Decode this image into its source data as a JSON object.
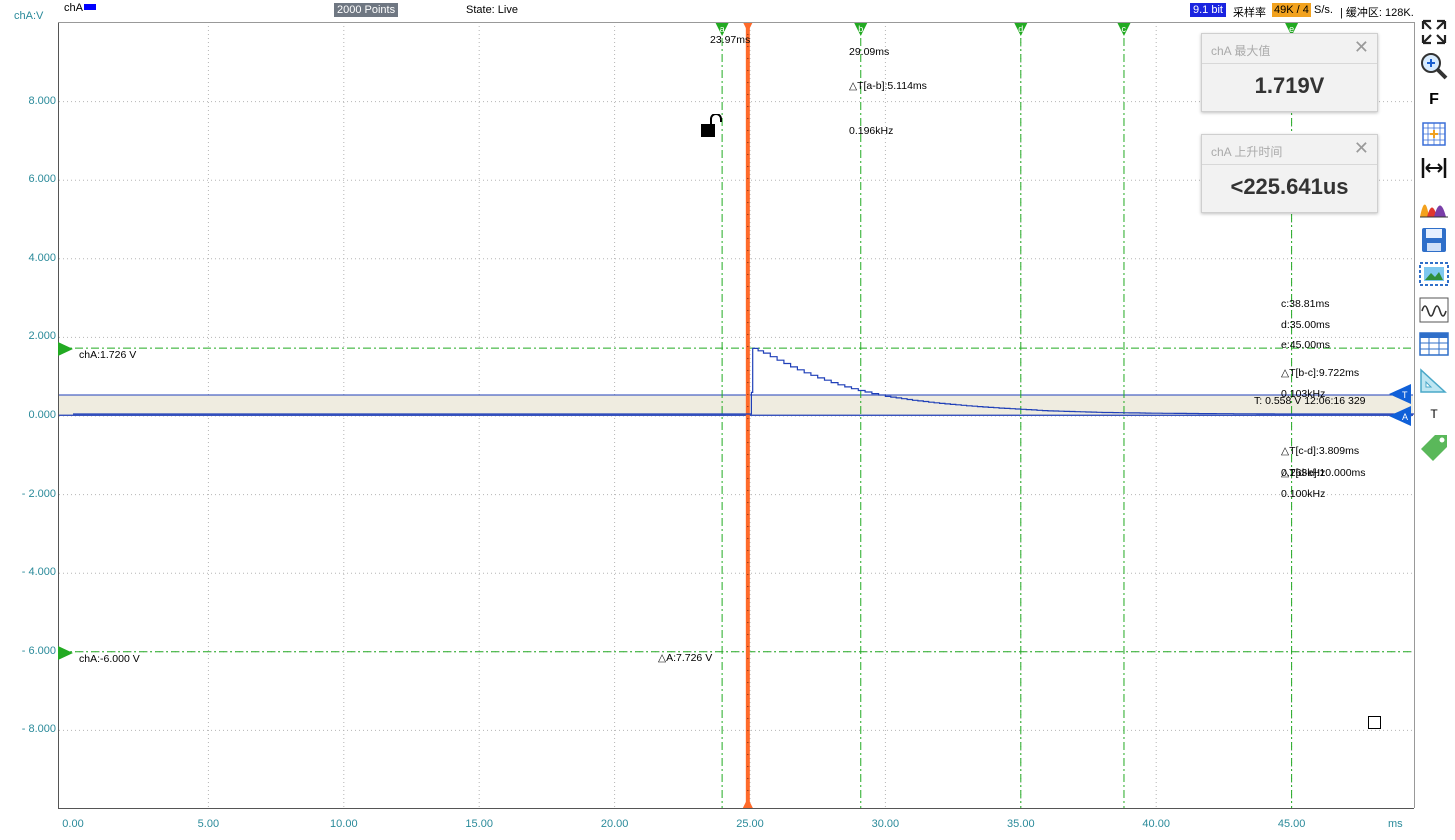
{
  "topbar": {
    "channel": "chA",
    "points": "2000 Points",
    "state": "State: Live",
    "bits": "9.1 bit",
    "rate_label": "采样率",
    "rate_value": "49K / 4",
    "rate_unit": "S/s.",
    "buffer": "| 缓冲区: 128K."
  },
  "axes": {
    "y_unit": "chA:V",
    "x_unit": "ms",
    "y_ticks": [
      "8.000",
      "6.000",
      "4.000",
      "2.000",
      "0.000",
      "- 2.000",
      "- 4.000",
      "- 6.000",
      "- 8.000"
    ],
    "x_ticks": [
      "0.00",
      "5.00",
      "10.00",
      "15.00",
      "20.00",
      "25.00",
      "30.00",
      "35.00",
      "40.00",
      "45.00"
    ]
  },
  "markers": {
    "cursor_letters": [
      "a",
      "b",
      "d",
      "c",
      "e"
    ],
    "a_time": "23.97ms",
    "b_time": "29.09ms",
    "dt_ab": "△T[a-b]:5.114ms",
    "f_ab": "0.196kHz",
    "c_time": "c:38.81ms",
    "d_time": "d:35.00ms",
    "e_time": "e:45.00ms",
    "dt_bc": "△T[b-c]:9.722ms",
    "f_bc": "0.103kHz",
    "dt_cd": "△T[c-d]:3.809ms",
    "f_cd": "0.263kHz",
    "dt_de": "△T[d-e]:10.000ms",
    "f_de": "0.100kHz",
    "level_high": "chA:1.726 V",
    "level_low": "chA:-6.000 V",
    "delta_a": "△A:7.726 V",
    "trigger_info": "T: 0.558 V  12:06:16 329",
    "trigger_flag": "T",
    "channel_flag": "A"
  },
  "popups": [
    {
      "title": "chA 最大值",
      "value": "1.719V"
    },
    {
      "title": "chA 上升时间",
      "value": "<225.641us"
    }
  ],
  "toolbar": {
    "tools": [
      "fullscreen-icon",
      "zoom-icon",
      "font-icon",
      "grid-select-icon",
      "measure-width-icon",
      "spectrum-icon",
      "save-icon",
      "screenshot-icon",
      "waveform-icon",
      "table-icon",
      "ruler-icon",
      "text-icon",
      "tag-icon"
    ],
    "font_glyph": "F",
    "text_glyph": "T"
  },
  "colors": {
    "grid": "#b5b5b5",
    "trace": "#1f3fb8",
    "cursor": "#22aa22",
    "trigger_cursor": "#ff6a2a",
    "axis_text": "#2a8a9a",
    "trigger_band": "#efece0",
    "marker_blue": "#1060d8"
  },
  "chart_data": {
    "type": "line",
    "x_range": [
      0,
      50
    ],
    "y_range": [
      -10,
      10
    ],
    "grid": true,
    "series": [
      {
        "name": "chA",
        "x": [
          0,
          24.5,
          24.9,
          25.05,
          25.1,
          25.5,
          26,
          26.5,
          27,
          27.5,
          28,
          28.5,
          29,
          29.5,
          30,
          31,
          32,
          33,
          34,
          35,
          36,
          37,
          38,
          39,
          40,
          42,
          45,
          50
        ],
        "y": [
          0.05,
          0.05,
          0.05,
          0.6,
          1.72,
          1.6,
          1.42,
          1.25,
          1.1,
          0.97,
          0.85,
          0.74,
          0.65,
          0.57,
          0.5,
          0.4,
          0.32,
          0.26,
          0.21,
          0.17,
          0.13,
          0.11,
          0.09,
          0.08,
          0.07,
          0.06,
          0.05,
          0.05
        ]
      }
    ]
  }
}
